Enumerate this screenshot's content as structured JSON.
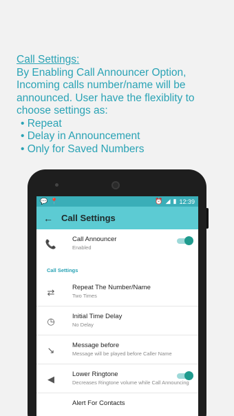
{
  "promo": {
    "heading": "Call Settings:",
    "body": "By Enabling Call Announcer Option, Incoming calls number/name will be announced. User have the flexiblity to choose settings as:",
    "bullets": [
      "Repeat",
      "Delay in Announcement",
      "Only for Saved Numbers"
    ]
  },
  "statusbar": {
    "time": "12:39"
  },
  "appbar": {
    "title": "Call Settings"
  },
  "announcer": {
    "title": "Call Announcer",
    "sub": "Enabled",
    "enabled": true
  },
  "section_label": "Call Settings",
  "items": [
    {
      "title": "Repeat The Number/Name",
      "sub": "Two Times",
      "icon": "repeat-icon"
    },
    {
      "title": "Initial Time Delay",
      "sub": "No Delay",
      "icon": "timer-icon"
    },
    {
      "title": "Message before",
      "sub": "Message will be played before Caller Name",
      "icon": "call-received-icon"
    },
    {
      "title": "Lower Ringtone",
      "sub": "Decreases Ringtone volume while Call Announcing",
      "icon": "speaker-icon",
      "toggle": true
    },
    {
      "title": "Alert For Contacts",
      "sub": "",
      "icon": "contacts-icon"
    }
  ],
  "colors": {
    "accent": "#2aa3b5",
    "appbar": "#5ccbd3",
    "statusbar": "#3aaeb8",
    "toggle": "#1f9b8e"
  }
}
